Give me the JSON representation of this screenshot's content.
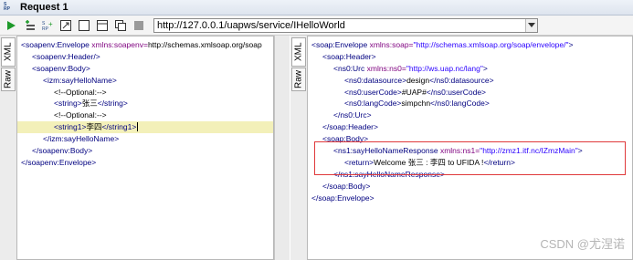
{
  "window": {
    "title": "Request 1"
  },
  "toolbar": {
    "buttons": [
      "run-icon",
      "add-assertion-icon",
      "add-wss-icon",
      "resize-icon",
      "split-icon",
      "tab-layout-icon",
      "copy-icon",
      "stop-icon"
    ],
    "url": "http://127.0.0.1/uapws/service/IHelloWorld"
  },
  "request": {
    "tabs": [
      "XML",
      "Raw"
    ],
    "lines": [
      {
        "indent": 0,
        "text": "<soapenv:Envelope xmlns:soapenv=\"http://schemas.xmlsoap.org/soap"
      },
      {
        "indent": 1,
        "text": "<soapenv:Header/>"
      },
      {
        "indent": 1,
        "text": "<soapenv:Body>"
      },
      {
        "indent": 2,
        "text": "<izm:sayHelloName>"
      },
      {
        "indent": 3,
        "text": "<!--Optional:-->"
      },
      {
        "indent": 3,
        "text": "<string>张三</string>"
      },
      {
        "indent": 3,
        "text": "<!--Optional:-->"
      },
      {
        "indent": 3,
        "text": "<string1>李四</string1>",
        "highlight": true
      },
      {
        "indent": 2,
        "text": "</izm:sayHelloName>"
      },
      {
        "indent": 1,
        "text": "</soapenv:Body>"
      },
      {
        "indent": 0,
        "text": "</soapenv:Envelope>"
      }
    ]
  },
  "response": {
    "tabs": [
      "XML",
      "Raw"
    ],
    "lines": [
      {
        "indent": 0,
        "text": "<soap:Envelope xmlns:soap=\"http://schemas.xmlsoap.org/soap/envelope/\">"
      },
      {
        "indent": 1,
        "text": "<soap:Header>"
      },
      {
        "indent": 2,
        "text": "<ns0:Urc xmlns:ns0=\"http://ws.uap.nc/lang\">"
      },
      {
        "indent": 3,
        "text": "<ns0:datasource>design</ns0:datasource>"
      },
      {
        "indent": 3,
        "text": "<ns0:userCode>#UAP#</ns0:userCode>"
      },
      {
        "indent": 3,
        "text": "<ns0:langCode>simpchn</ns0:langCode>"
      },
      {
        "indent": 2,
        "text": "</ns0:Urc>"
      },
      {
        "indent": 1,
        "text": "</soap:Header>"
      },
      {
        "indent": 1,
        "text": "<soap:Body>"
      },
      {
        "indent": 2,
        "text": "<ns1:sayHelloNameResponse xmlns:ns1=\"http://zmz1.itf.nc/IZmzMain\">"
      },
      {
        "indent": 3,
        "text": "<return>Welcome 张三 : 李四 to UFIDA !</return>"
      },
      {
        "indent": 2,
        "text": "</ns1:sayHelloNameResponse>"
      },
      {
        "indent": 1,
        "text": "</soap:Body>"
      },
      {
        "indent": 0,
        "text": "</soap:Envelope>"
      }
    ]
  },
  "watermark": "CSDN @尤涅诺",
  "colors": {
    "tag": "#000080",
    "attr": "#7f007f",
    "value": "#2a00ff",
    "highlight": "#f3f0b9",
    "box": "#e0393b"
  }
}
